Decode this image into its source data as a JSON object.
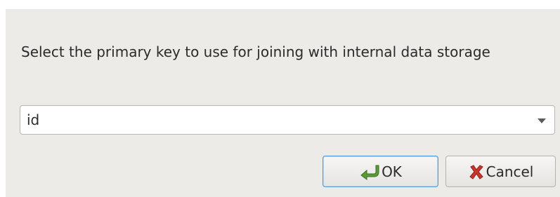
{
  "dialog": {
    "prompt": "Select the primary key to use for joining with internal data storage",
    "key_select": {
      "value": "id"
    },
    "buttons": {
      "ok": {
        "label": "OK",
        "icon": "ok-arrow-icon"
      },
      "cancel": {
        "label": "Cancel",
        "icon": "cancel-x-icon"
      }
    }
  },
  "colors": {
    "dialog_background": "#edebe8",
    "default_button_border": "#4d9ad6",
    "ok_icon": "#5a9a3a",
    "cancel_icon": "#c8372d"
  }
}
